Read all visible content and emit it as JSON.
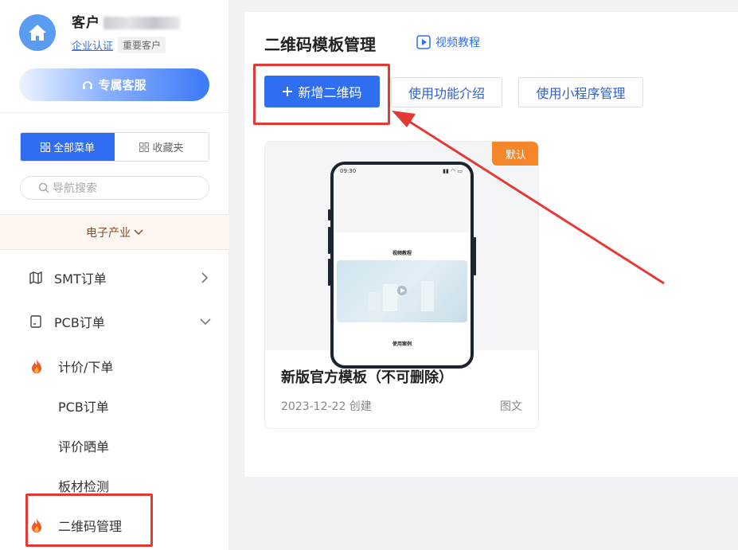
{
  "sidebar": {
    "user_name": "客户",
    "cert_link": "企业认证",
    "customer_tag": "重要客户",
    "service_button": "专属客服",
    "tab_all": "全部菜单",
    "tab_fav": "收藏夹",
    "search_placeholder": "导航搜索",
    "industry": "电子产业",
    "menu": [
      {
        "label": "SMT订单",
        "icon": "map-icon"
      },
      {
        "label": "PCB订单",
        "icon": "board-icon"
      }
    ],
    "submenu": [
      {
        "label": "计价/下单",
        "icon": "fire-icon"
      },
      {
        "label": "PCB订单"
      },
      {
        "label": "评价晒单"
      },
      {
        "label": "板材检测"
      },
      {
        "label": "二维码管理",
        "icon": "fire-icon"
      }
    ]
  },
  "main": {
    "title": "二维码模板管理",
    "video_link": "视频教程",
    "btn_add": "新增二维码",
    "btn_intro": "使用功能介绍",
    "btn_miniprogram": "使用小程序管理",
    "card": {
      "badge": "默认",
      "phone_time": "09:30",
      "phone_section1": "视频教程",
      "phone_section2": "使用案例",
      "title": "新版官方模板（不可删除）",
      "date": "2023-12-22 创建",
      "type": "图文"
    }
  },
  "colors": {
    "primary": "#2f6ef0",
    "badge": "#f6862a",
    "highlight": "#e53935"
  }
}
